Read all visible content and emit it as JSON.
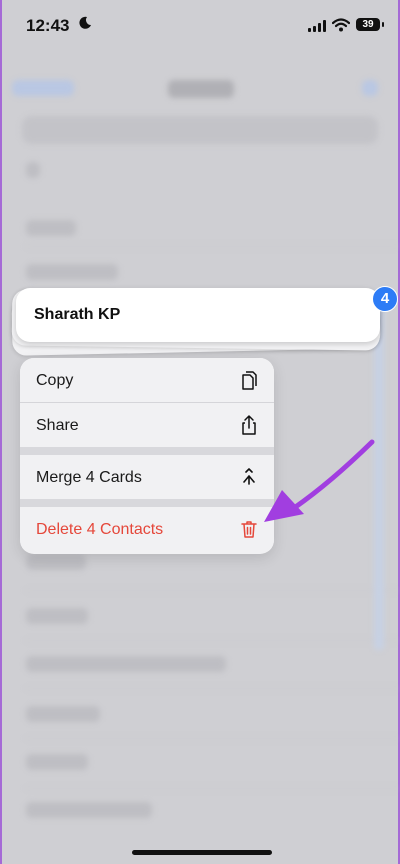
{
  "status_bar": {
    "time": "12:43",
    "battery": "39"
  },
  "contact": {
    "name": "Sharath KP",
    "selected_count": "4"
  },
  "menu": {
    "copy": {
      "label": "Copy",
      "icon": "copy-icon"
    },
    "share": {
      "label": "Share",
      "icon": "share-icon"
    },
    "merge": {
      "label": "Merge 4 Cards",
      "icon": "merge-icon"
    },
    "delete": {
      "label": "Delete 4 Contacts",
      "icon": "trash-icon",
      "color": "#e5473a"
    }
  },
  "colors": {
    "accent": "#2d7cf6",
    "annotation_arrow": "#a13ee0",
    "destructive": "#e5473a"
  }
}
